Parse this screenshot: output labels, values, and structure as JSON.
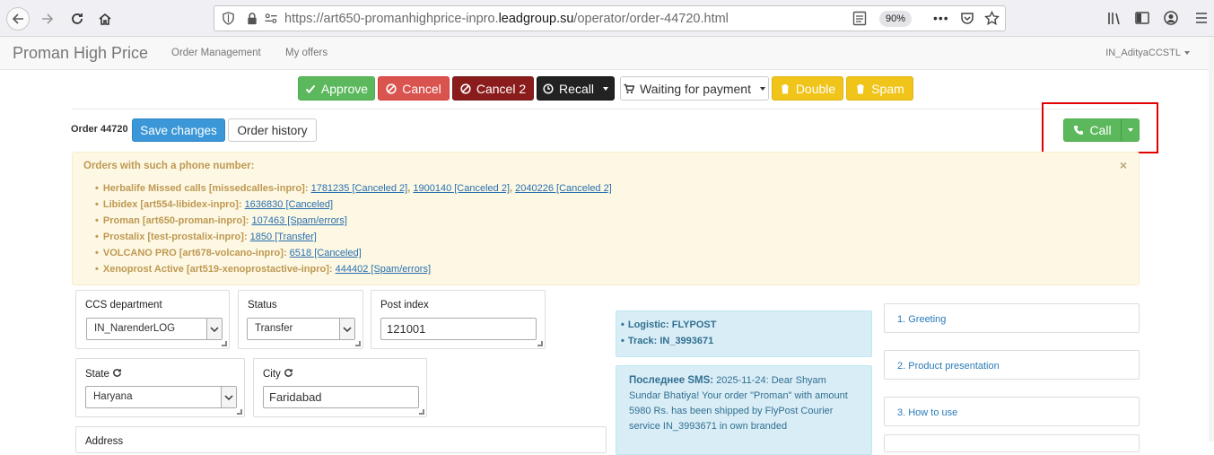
{
  "browser": {
    "url_prefix": "https://art650-promanhighprice-inpro.",
    "url_domain": "leadgroup.su",
    "url_path": "/operator/order-44720.html",
    "zoom": "90%",
    "more": "•••"
  },
  "navbar": {
    "brand": "Proman High Price",
    "links": [
      "Order Management",
      "My offers"
    ],
    "user": "IN_AdityaCCSTL"
  },
  "actions": {
    "approve": "Approve",
    "cancel": "Cancel",
    "cancel2": "Cancel 2",
    "recall": "Recall",
    "waiting": "Waiting for payment",
    "double": "Double",
    "spam": "Spam"
  },
  "order": {
    "label": "Order 44720",
    "save": "Save changes",
    "history": "Order history",
    "call": "Call"
  },
  "alert": {
    "title": "Orders with such a phone number:",
    "close": "×",
    "items": [
      {
        "name": "Herbalife Missed calls [missedcalles-inpro]",
        "links": [
          "1781235 [Canceled 2]",
          "1900140 [Canceled 2]",
          "2040226 [Canceled 2]"
        ]
      },
      {
        "name": "Libidex [art554-libidex-inpro]",
        "links": [
          "1636830 [Canceled]"
        ]
      },
      {
        "name": "Proman [art650-proman-inpro]",
        "links": [
          "107463 [Spam/errors]"
        ]
      },
      {
        "name": "Prostalix [test-prostalix-inpro]",
        "links": [
          "1850 [Transfer]"
        ]
      },
      {
        "name": "VOLCANO PRO [art678-volcano-inpro]",
        "links": [
          "6518 [Canceled]"
        ]
      },
      {
        "name": "Xenoprost Active [art519-xenoprostactive-inpro]",
        "links": [
          "444402 [Spam/errors]"
        ]
      }
    ]
  },
  "form": {
    "ccs_label": "CCS department",
    "ccs_value": "IN_NarenderLOG",
    "status_label": "Status",
    "status_value": "Transfer",
    "post_label": "Post index",
    "post_value": "121001",
    "state_label": "State",
    "state_value": "Haryana",
    "city_label": "City",
    "city_value": "Faridabad",
    "address_label": "Address"
  },
  "logistics": {
    "logistic": "Logistic: FLYPOST",
    "track": "Track: IN_3993671"
  },
  "sms": {
    "label": "Последнее SMS:",
    "text": "2025-11-24: Dear Shyam Sundar Bhatiya! Your order \"Proman\" with amount 5980 Rs. has been shipped by FlyPost Courier service IN_3993671 in own branded"
  },
  "script": {
    "items": [
      "1. Greeting",
      "2. Product presentation",
      "3. How to use"
    ]
  },
  "colors": {
    "success": "#5cb85c",
    "danger": "#d9534f",
    "warning": "#f0c419",
    "primary": "#3b97d8",
    "highlight": "#e00000"
  }
}
